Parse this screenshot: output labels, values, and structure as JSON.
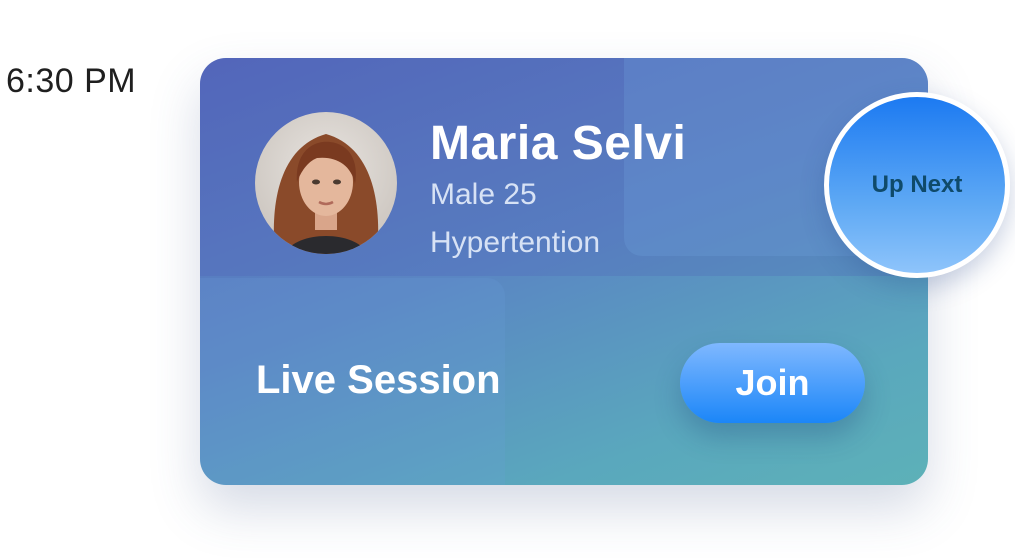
{
  "time": "6:30 PM",
  "patient": {
    "name": "Maria Selvi",
    "gender_age": "Male 25",
    "condition": "Hypertention"
  },
  "session": {
    "label": "Live Session",
    "join_label": "Join"
  },
  "badge": {
    "label": "Up Next"
  },
  "colors": {
    "card_start": "#5468bb",
    "card_end": "#5db1b8",
    "join_button": "#1b86f8",
    "badge_text": "#0f4a6a"
  }
}
